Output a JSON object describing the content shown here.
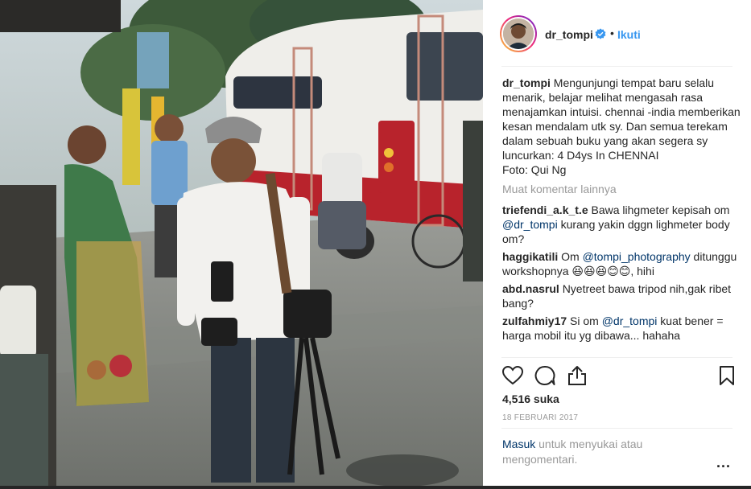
{
  "post": {
    "username": "dr_tompi",
    "follow_label": "Ikuti",
    "separator": "•"
  },
  "caption": {
    "username": "dr_tompi",
    "text": "Mengunjungi tempat baru selalu menarik, belajar melihat mengasah rasa menajamkan intuisi. chennai -india memberikan kesan mendalam utk sy. Dan semua terekam dalam sebuah buku yang akan segera sy luncurkan: 4 D4ys In CHENNAI\nFoto: Qui Ng"
  },
  "load_more_label": "Muat komentar lainnya",
  "comments": [
    {
      "username": "triefendi_a.k_t.e",
      "pre": "Bawa lihgmeter kepisah om ",
      "mention": "@dr_tompi",
      "post": " kurang yakin dggn lighmeter body om?"
    },
    {
      "username": "haggikatili",
      "pre": "Om ",
      "mention": "@tompi_photography",
      "post": " ditunggu workshopnya 😆😆😆😊😊, hihi"
    },
    {
      "username": "abd.nasrul",
      "pre": "Nyetreet bawa tripod nih,gak ribet bang?",
      "mention": "",
      "post": ""
    },
    {
      "username": "zulfahmiy17",
      "pre": "Si om ",
      "mention": "@dr_tompi",
      "post": " kuat bener = harga mobil itu yg dibawa... hahaha"
    }
  ],
  "likes_label": "4,516 suka",
  "date_label": "18 FEBRUARI 2017",
  "login": {
    "link": "Masuk",
    "text": " untuk menyukai atau mengomentari."
  },
  "more_label": "...",
  "icons": {
    "like": "heart-icon",
    "comment": "comment-icon",
    "share": "share-icon",
    "save": "bookmark-icon",
    "verified": "verified-badge-icon"
  },
  "colors": {
    "link": "#3897f0",
    "mention": "#003569",
    "muted": "#999999"
  }
}
